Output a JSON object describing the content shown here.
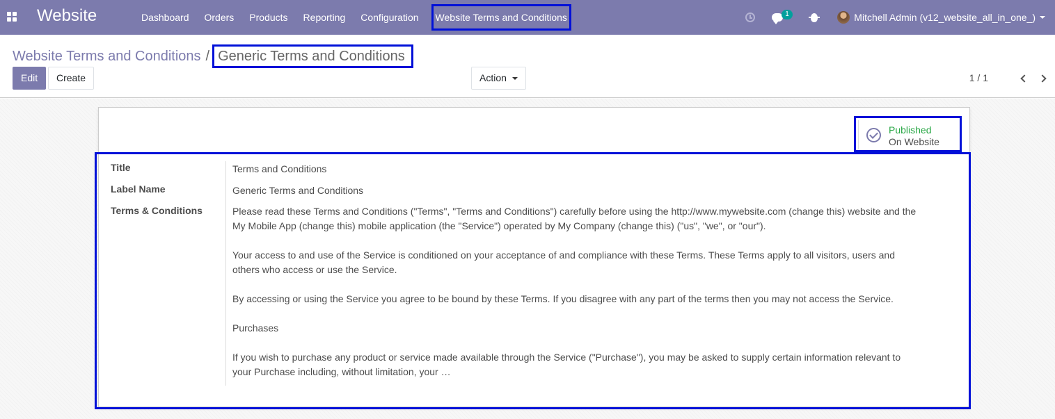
{
  "navbar": {
    "brand": "Website",
    "menu": [
      "Dashboard",
      "Orders",
      "Products",
      "Reporting",
      "Configuration",
      "Website Terms and Conditions"
    ],
    "messages_badge": "1",
    "user": "Mitchell Admin (v12_website_all_in_one_)"
  },
  "breadcrumb": {
    "parent": "Website Terms and Conditions",
    "separator": "/",
    "current": "Generic Terms and Conditions"
  },
  "buttons": {
    "edit": "Edit",
    "create": "Create",
    "action": "Action"
  },
  "pager": "1 / 1",
  "publish": {
    "status": "Published",
    "where": "On Website"
  },
  "fields": {
    "title_label": "Title",
    "title_value": "Terms and Conditions",
    "label_name_label": "Label Name",
    "label_name_value": "Generic Terms and Conditions",
    "terms_label": "Terms & Conditions",
    "terms_paragraphs": [
      "Please read these Terms and Conditions (\"Terms\", \"Terms and Conditions\") carefully before using the http://www.mywebsite.com (change this) website and the My Mobile App (change this) mobile application (the \"Service\") operated by My Company (change this) (\"us\", \"we\", or \"our\").",
      "Your access to and use of the Service is conditioned on your acceptance of and compliance with these Terms. These Terms apply to all visitors, users and others who access or use the Service.",
      "By accessing or using the Service you agree to be bound by these Terms. If you disagree with any part of the terms then you may not access the Service.",
      "Purchases",
      "If you wish to purchase any product or service made available through the Service (\"Purchase\"), you may be asked to supply certain information relevant to your Purchase including, without limitation, your …"
    ]
  },
  "colors": {
    "navbar": "#7c7bad",
    "highlight": "#0010d8",
    "published": "#28a745"
  }
}
